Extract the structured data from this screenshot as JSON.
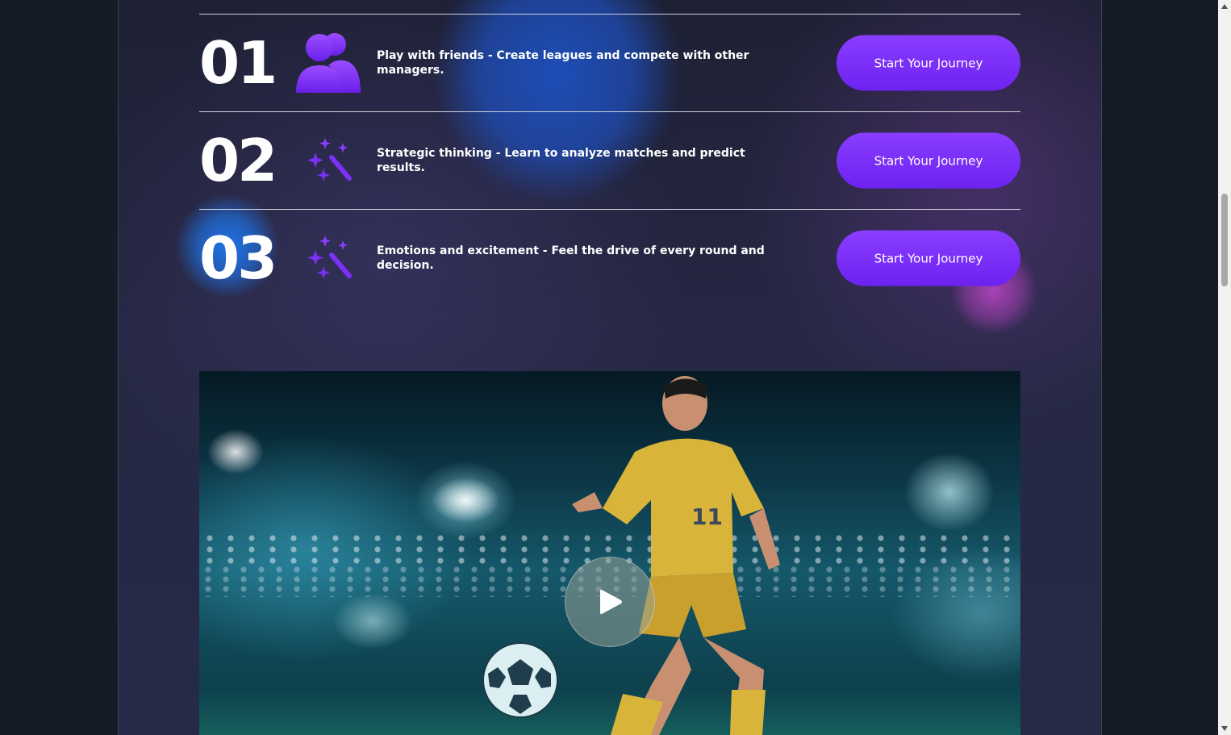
{
  "features": [
    {
      "number": "01",
      "icon": "users-icon",
      "text": "Play with friends - Create leagues and compete with other managers.",
      "button_label": "Start Your Journey"
    },
    {
      "number": "02",
      "icon": "magic-wand-icon",
      "text": "Strategic thinking - Learn to analyze matches and predict results.",
      "button_label": "Start Your Journey"
    },
    {
      "number": "03",
      "icon": "magic-wand-icon",
      "text": "Emotions and excitement - Feel the drive of every round and decision.",
      "button_label": "Start Your Journey"
    }
  ],
  "video": {
    "play_icon": "play-icon",
    "player_jersey_number": "11"
  },
  "colors": {
    "accent": "#7b2ff7",
    "background": "#1e2034",
    "text": "#ffffff"
  }
}
